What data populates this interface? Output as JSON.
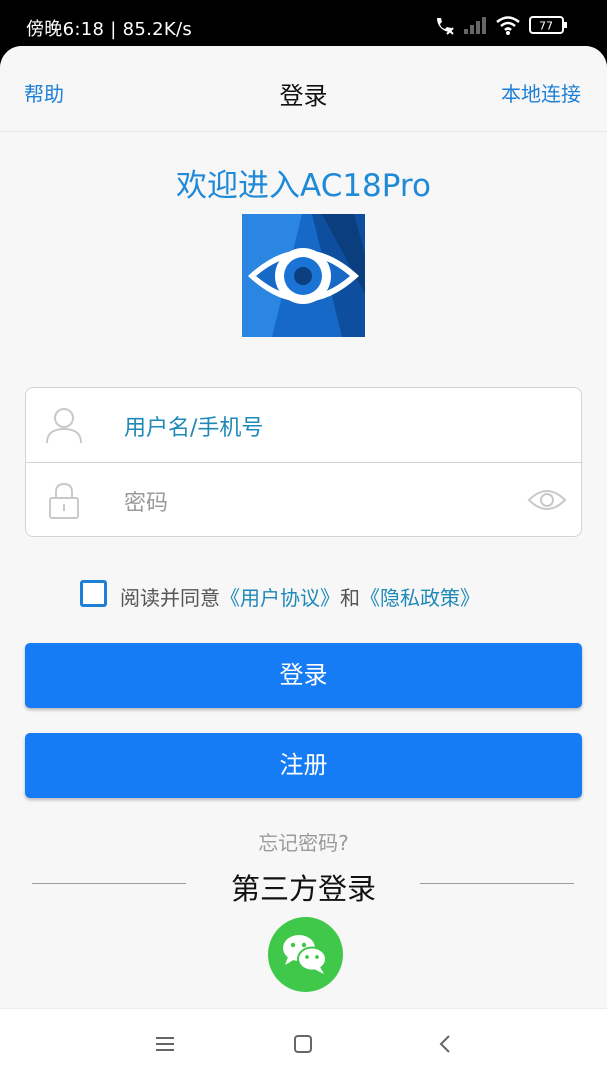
{
  "status_bar": {
    "time_speed": "傍晚6:18 | 85.2K/s",
    "battery": "77"
  },
  "appbar": {
    "help": "帮助",
    "title": "登录",
    "local_connect": "本地连接"
  },
  "welcome": "欢迎进入AC18Pro",
  "form": {
    "username_placeholder": "用户名/手机号",
    "password_placeholder": "密码"
  },
  "agreement": {
    "prefix": "阅读并同意",
    "user_agreement": "《用户协议》",
    "and": "和",
    "privacy_policy": "《隐私政策》",
    "checked": false
  },
  "buttons": {
    "login": "登录",
    "register": "注册"
  },
  "forgot_password": "忘记密码?",
  "third_party": {
    "title": "第三方登录",
    "providers": [
      "wechat"
    ]
  },
  "colors": {
    "accent": "#157cf5",
    "link": "#1e89b8",
    "wechat": "#3fc84a"
  },
  "icons": [
    "user-icon",
    "lock-icon",
    "eye-icon",
    "wechat-icon",
    "menu-icon",
    "home-icon",
    "back-icon",
    "app-logo"
  ]
}
